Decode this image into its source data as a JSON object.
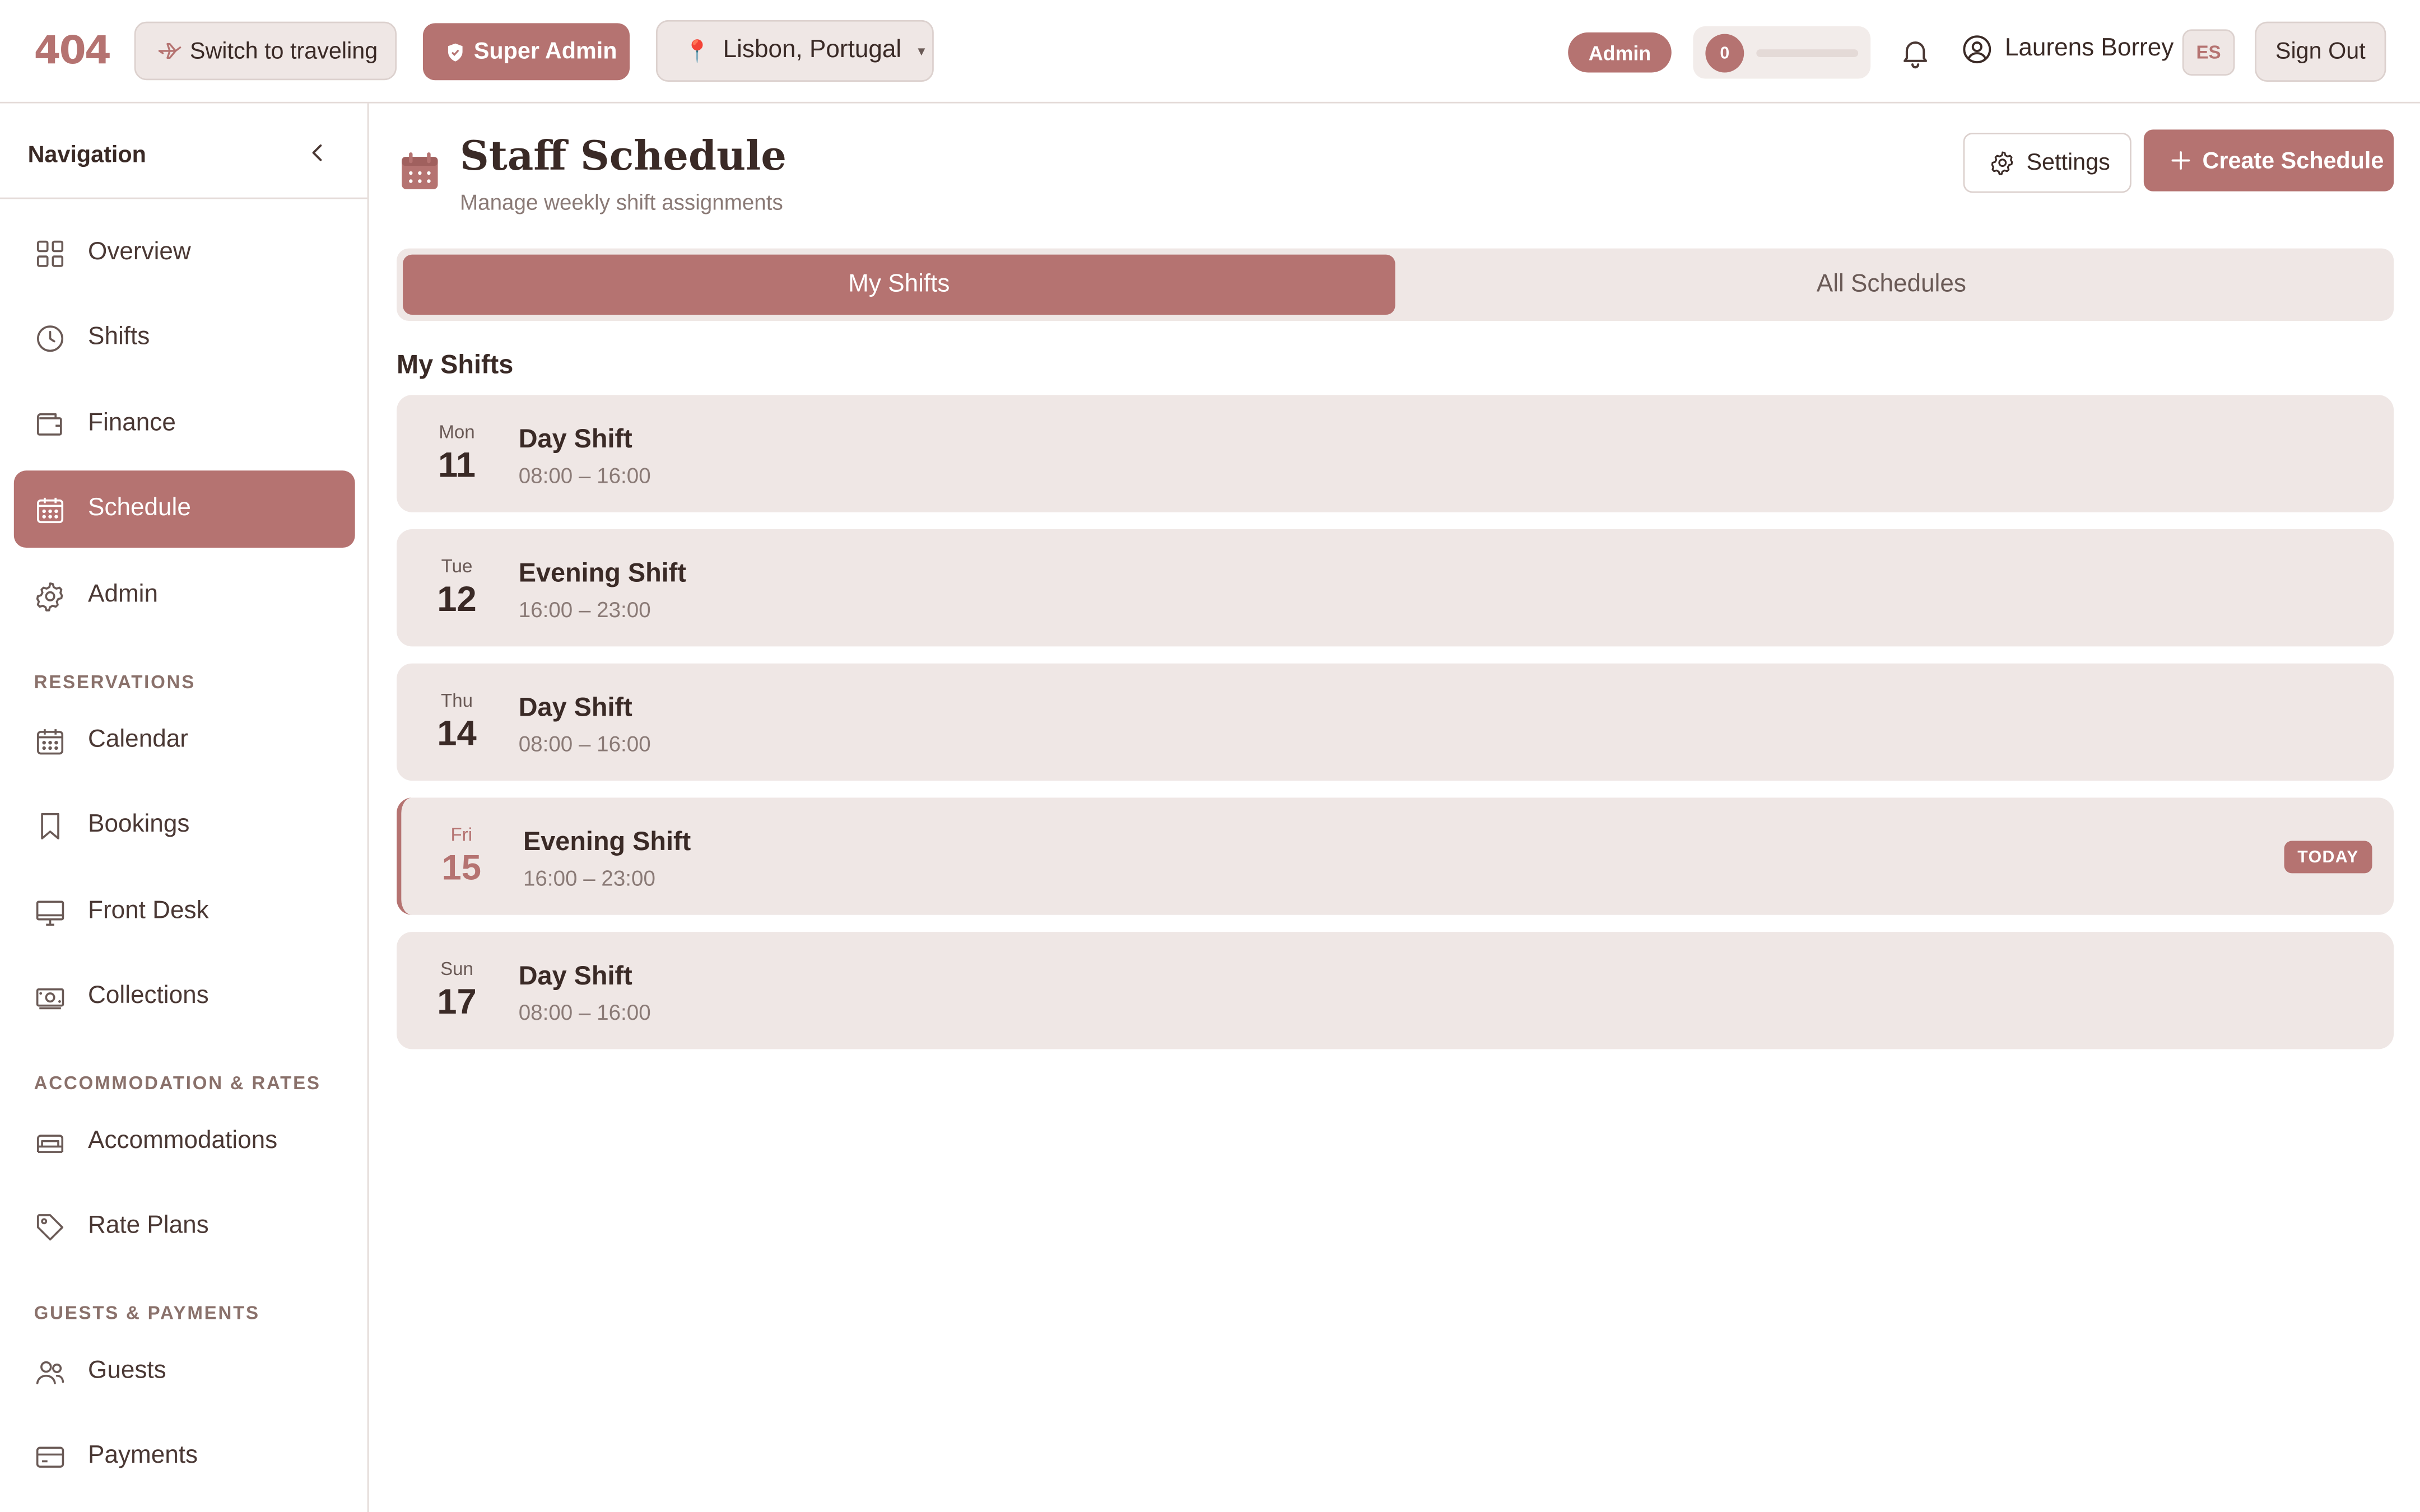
{
  "topbar": {
    "logo": "404",
    "travel_label": "Switch to traveling",
    "role_label": "Super Admin",
    "location": "Lisbon, Portugal",
    "admin_badge": "Admin",
    "progress_count": "0",
    "progress_fraction": 0,
    "user_name": "Laurens Borrey",
    "language": "ES",
    "sign_out": "Sign Out"
  },
  "sidebar": {
    "title": "Navigation",
    "main_items": [
      {
        "label": "Overview",
        "icon": "grid-icon"
      },
      {
        "label": "Shifts",
        "icon": "clock-icon"
      },
      {
        "label": "Finance",
        "icon": "wallet-icon"
      },
      {
        "label": "Schedule",
        "icon": "calendar-icon",
        "active": true
      },
      {
        "label": "Admin",
        "icon": "gear-icon"
      }
    ],
    "sections": [
      {
        "title": "RESERVATIONS",
        "items": [
          {
            "label": "Calendar",
            "icon": "calendar-icon"
          },
          {
            "label": "Bookings",
            "icon": "bookmark-icon"
          },
          {
            "label": "Front Desk",
            "icon": "monitor-icon"
          },
          {
            "label": "Collections",
            "icon": "banknote-icon"
          }
        ]
      },
      {
        "title": "ACCOMMODATION & RATES",
        "items": [
          {
            "label": "Accommodations",
            "icon": "bed-icon"
          },
          {
            "label": "Rate Plans",
            "icon": "tag-icon"
          }
        ]
      },
      {
        "title": "GUESTS & PAYMENTS",
        "items": [
          {
            "label": "Guests",
            "icon": "users-icon"
          },
          {
            "label": "Payments",
            "icon": "credit-card-icon"
          }
        ]
      }
    ]
  },
  "header": {
    "title": "Staff Schedule",
    "subtitle": "Manage weekly shift assignments",
    "settings_label": "Settings",
    "create_label": "Create Schedule"
  },
  "tabs": [
    {
      "label": "My Shifts",
      "active": true
    },
    {
      "label": "All Schedules",
      "active": false
    }
  ],
  "shifts_section_title": "My Shifts",
  "shifts": [
    {
      "dow": "Mon",
      "day": "11",
      "name": "Day Shift",
      "time": "08:00 – 16:00"
    },
    {
      "dow": "Tue",
      "day": "12",
      "name": "Evening Shift",
      "time": "16:00 – 23:00"
    },
    {
      "dow": "Thu",
      "day": "14",
      "name": "Day Shift",
      "time": "08:00 – 16:00"
    },
    {
      "dow": "Fri",
      "day": "15",
      "name": "Evening Shift",
      "time": "16:00 – 23:00",
      "today": true,
      "badge": "TODAY"
    },
    {
      "dow": "Sun",
      "day": "17",
      "name": "Day Shift",
      "time": "08:00 – 16:00"
    }
  ],
  "colors": {
    "accent": "#b57371",
    "surface": "#efe7e5",
    "text": "#3a2a26",
    "pin": "#d9455b"
  }
}
